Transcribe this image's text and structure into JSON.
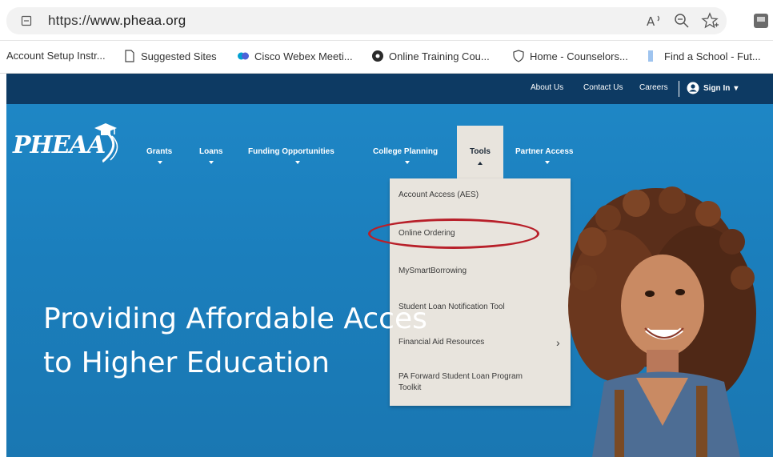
{
  "browser": {
    "url_scheme": "https://",
    "url_host": "www.pheaa.org",
    "icons": [
      "lock-icon",
      "read-aloud-icon",
      "zoom-icon",
      "favorite-star-icon",
      "extension-icon"
    ]
  },
  "favorites": [
    {
      "label": "Account Setup Instr...",
      "icon": "none"
    },
    {
      "label": "Suggested Sites",
      "icon": "page-icon"
    },
    {
      "label": "Cisco Webex Meeti...",
      "icon": "webex-icon"
    },
    {
      "label": "Online Training Cou...",
      "icon": "dark-circle-icon"
    },
    {
      "label": "Home - Counselors...",
      "icon": "shield-icon"
    },
    {
      "label": "Find a School - Fut...",
      "icon": "doc-icon"
    }
  ],
  "site": {
    "utility": {
      "about": "About Us",
      "contact": "Contact Us",
      "careers": "Careers",
      "signin": "Sign In"
    },
    "logo": "PHEAA",
    "nav": {
      "grants": "Grants",
      "loans": "Loans",
      "funding": "Funding Opportunities",
      "college": "College Planning",
      "tools": "Tools",
      "partner": "Partner Access"
    },
    "tools_menu": {
      "item1": "Account Access (AES)",
      "item2": "Online Ordering",
      "item3": "MySmartBorrowing",
      "item4": "Student Loan Notification Tool",
      "item5": "Financial Aid Resources",
      "item6": "PA Forward Student Loan Program Toolkit"
    },
    "hero": {
      "line1": "Providing Affordable Acces",
      "line2": "to Higher Education"
    }
  },
  "colors": {
    "utility_bar": "#0d3a63",
    "hero_blue": "#1b7fbd",
    "dropdown_bg": "#e8e4dd",
    "highlight": "#b8202a"
  }
}
